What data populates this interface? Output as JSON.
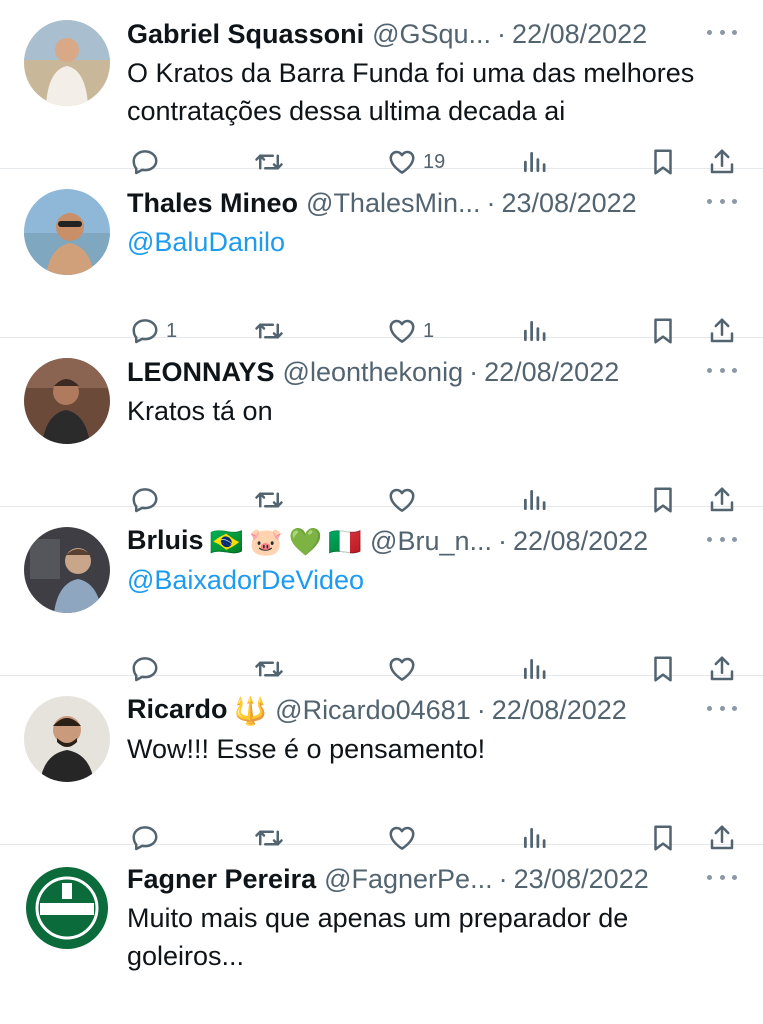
{
  "tweets": [
    {
      "name": "Gabriel Squassoni",
      "emojis": [],
      "handle": "@GSqu...",
      "date": "22/08/2022",
      "text": "O Kratos da Barra Funda foi uma das melhores contratações dessa ultima decada ai",
      "is_link": false,
      "reply_count": "",
      "like_count": "19",
      "avatar_colors": {
        "bg": "#c9b79a",
        "fg": "#f3efe8",
        "skin": "#d8a887"
      }
    },
    {
      "name": "Thales Mineo",
      "emojis": [],
      "handle": "@ThalesMin...",
      "date": "23/08/2022",
      "text": "@BaluDanilo",
      "is_link": true,
      "reply_count": "1",
      "like_count": "1",
      "avatar_colors": {
        "bg": "#8fb8d8",
        "fg": "#cfa07a",
        "skin": "#c98f68"
      }
    },
    {
      "name": "LEONNAYS",
      "emojis": [],
      "handle": "@leonthekonig",
      "date": "22/08/2022",
      "text": "Kratos tá on",
      "is_link": false,
      "reply_count": "",
      "like_count": "",
      "avatar_colors": {
        "bg": "#6b4a3a",
        "fg": "#2b2b2b",
        "skin": "#b07a5e"
      }
    },
    {
      "name": "Brluis",
      "emojis": [
        "🇧🇷",
        "🐷",
        "💚",
        "🇮🇹"
      ],
      "handle": "@Bru_n...",
      "date": "22/08/2022",
      "text": "@BaixadorDeVideo",
      "is_link": true,
      "reply_count": "",
      "like_count": "",
      "avatar_colors": {
        "bg": "#3e3e44",
        "fg": "#8fa6c0",
        "skin": "#c9a58a"
      }
    },
    {
      "name": "Ricardo",
      "emojis": [
        "🔱"
      ],
      "handle": "@Ricardo04681",
      "date": "22/08/2022",
      "text": "Wow!!! Esse é o pensamento!",
      "is_link": false,
      "reply_count": "",
      "like_count": "",
      "avatar_colors": {
        "bg": "#e6e2dc",
        "fg": "#262626",
        "skin": "#c99a7c"
      }
    },
    {
      "name": "Fagner Pereira",
      "emojis": [],
      "handle": "@FagnerPe...",
      "date": "23/08/2022",
      "text": "Muito mais que apenas um preparador de goleiros...",
      "is_link": false,
      "reply_count": "",
      "like_count": "",
      "avatar_colors": {
        "bg": "#0b6b3a",
        "fg": "#ffffff",
        "skin": "#0b6b3a"
      }
    }
  ],
  "icons": {
    "reply": "reply-icon",
    "retweet": "retweet-icon",
    "like": "heart-icon",
    "views": "views-icon",
    "bookmark": "bookmark-icon",
    "share": "share-icon",
    "more": "more-options-icon"
  },
  "colors": {
    "text": "#0f1419",
    "secondary": "#536471",
    "link": "#1d9bf0",
    "divider": "#e4e8eb"
  }
}
